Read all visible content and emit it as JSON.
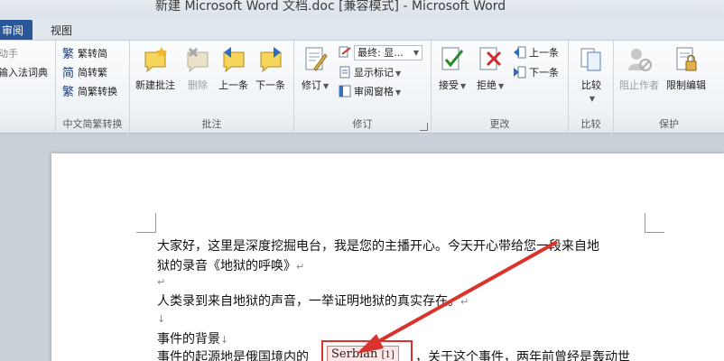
{
  "window": {
    "title": "新建 Microsoft Word 文档.doc [兼容模式] - Microsoft Word"
  },
  "tabs": {
    "active": "审阅",
    "view": "视图"
  },
  "ribbon": {
    "g_left": {
      "item1": "动手",
      "item2": "输入法词典"
    },
    "g_chinese": {
      "label": "中文简繁转换",
      "to_simplified": "繁转简",
      "to_traditional": "简转繁",
      "convert": "简繁转换"
    },
    "g_comments": {
      "label": "批注",
      "new": "新建批注",
      "delete": "删除",
      "prev": "上一条",
      "next": "下一条"
    },
    "g_tracking": {
      "label": "修订",
      "track": "修订",
      "display_value": "最终: 显...",
      "show_markup": "显示标记",
      "review_pane": "审阅窗格"
    },
    "g_changes": {
      "label": "更改",
      "accept": "接受",
      "reject": "拒绝",
      "prev": "上一条",
      "next": "下一条"
    },
    "g_compare": {
      "label": "比较",
      "compare": "比较"
    },
    "g_protect": {
      "label": "保护",
      "block_authors": "阻止作者",
      "restrict": "限制编辑"
    }
  },
  "document": {
    "line1": "大家好，这里是深度挖掘电台，我是您的主播开心。今天开心带给您一段来自地",
    "line2": "狱的录音《地狱的呼唤》",
    "line3": "人类录到来自地狱的声音，一举证明地狱的真实存在。",
    "line4": "事件的背景",
    "line5a": "事件的起源地是俄国境内的",
    "line5b": "，关于这个事件，两年前曾经是轰动世",
    "inserted_text": "Serbian",
    "inserted_ref": "[1]",
    "para_mark": "↵",
    "line_mark": "↓"
  },
  "colors": {
    "accent": "#2b579a",
    "highlight": "#d9332b"
  }
}
